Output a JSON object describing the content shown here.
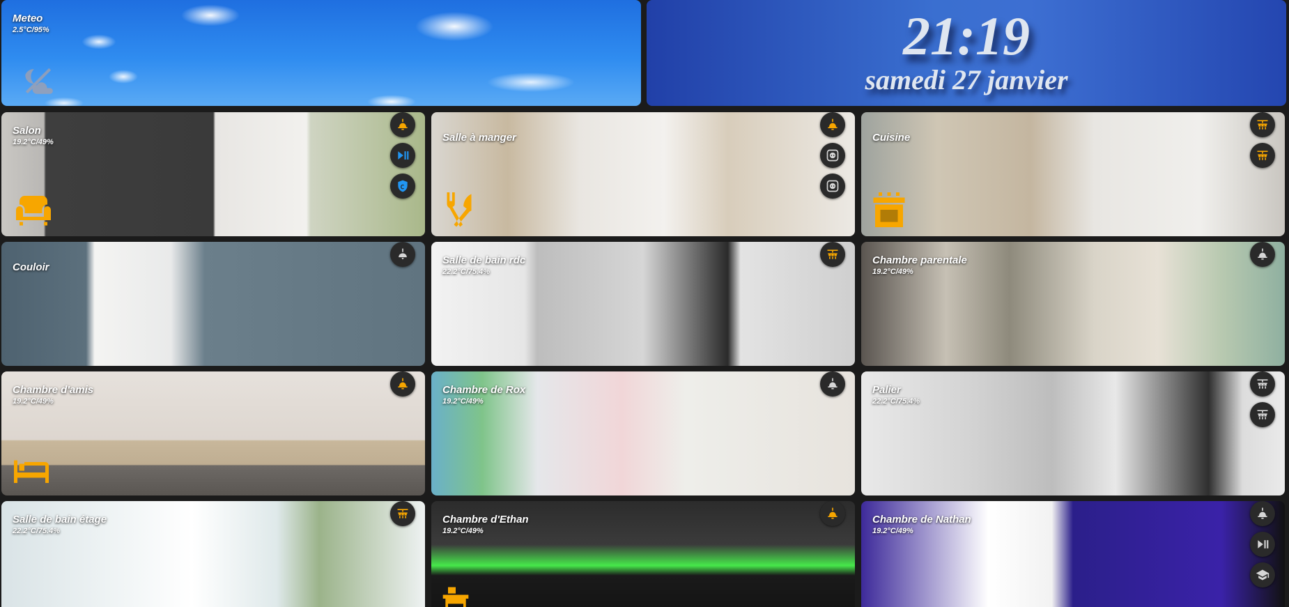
{
  "weather": {
    "title": "Meteo",
    "value": "2.5°C/95%",
    "icon": "weather-night-partly-cloudy-icon"
  },
  "clock": {
    "time": "21:19",
    "date": "samedi 27 janvier"
  },
  "colors": {
    "active": "#f7a600",
    "media": "#2196f3",
    "inactive": "#d6d6d6",
    "button_bg": "#2a2a2a"
  },
  "rooms": {
    "salon": {
      "name": "Salon",
      "sub": "19.2°C/49%",
      "icon": "sofa-icon"
    },
    "salle_a_manger": {
      "name": "Salle à manger",
      "sub": "",
      "icon": "silverware-icon"
    },
    "cuisine": {
      "name": "Cuisine",
      "sub": "",
      "icon": "stove-icon"
    },
    "couloir": {
      "name": "Couloir",
      "sub": ""
    },
    "salle_de_bain_rdc": {
      "name": "Salle de bain rdc",
      "sub": "22.2°C/75.4%"
    },
    "chambre_parentale": {
      "name": "Chambre parentale",
      "sub": "19.2°C/49%"
    },
    "chambre_amis": {
      "name": "Chambre d'amis",
      "sub": "19.2°C/49%",
      "icon": "bed-icon"
    },
    "chambre_rox": {
      "name": "Chambre de Rox",
      "sub": "19.2°C/49%"
    },
    "palier": {
      "name": "Palier",
      "sub": "22.2°C/75.4%"
    },
    "salle_de_bain_etage": {
      "name": "Salle de bain étage",
      "sub": "22.2°C/75.4%"
    },
    "chambre_ethan": {
      "name": "Chambre d'Ethan",
      "sub": "19.2°C/49%",
      "icon": "desk-icon"
    },
    "chambre_nathan": {
      "name": "Chambre de Nathan",
      "sub": "19.2°C/49%"
    }
  }
}
